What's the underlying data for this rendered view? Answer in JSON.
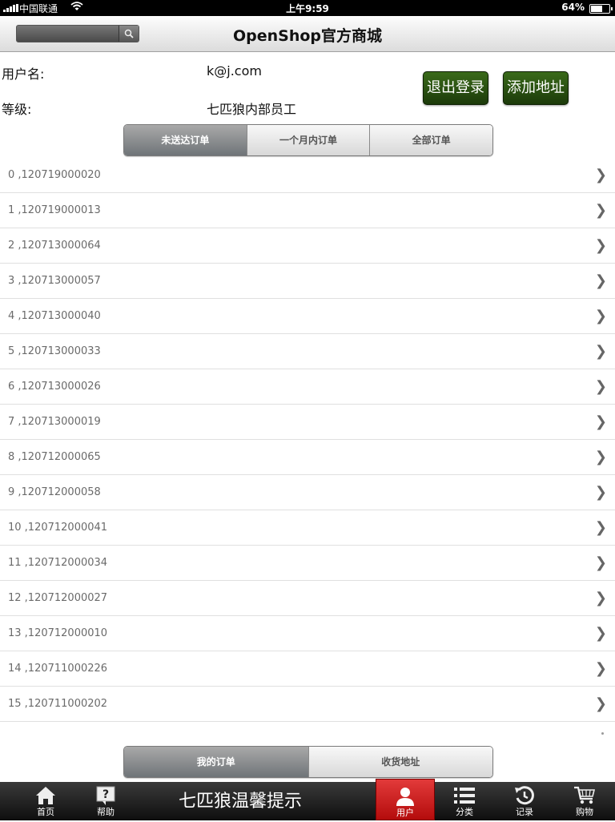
{
  "statusbar": {
    "carrier": "中国联通",
    "time": "上午9:59",
    "battery": "64%",
    "battery_level": 0.64
  },
  "nav": {
    "title": "OpenShop官方商城",
    "search_placeholder": "",
    "search_icon": "search-icon"
  },
  "user": {
    "username_label": "用户名:",
    "username_value": "k@j.com",
    "level_label": "等级:",
    "level_value": "七匹狼内部员工",
    "logout_label": "退出登录",
    "add_address_label": "添加地址"
  },
  "order_tabs": [
    {
      "label": "未送达订单",
      "active": true
    },
    {
      "label": "一个月内订单",
      "active": false
    },
    {
      "label": "全部订单",
      "active": false
    }
  ],
  "orders": [
    "0 ,120719000020",
    "1 ,120719000013",
    "2 ,120713000064",
    "3 ,120713000057",
    "4 ,120713000040",
    "5 ,120713000033",
    "6 ,120713000026",
    "7 ,120713000019",
    "8 ,120712000065",
    "9 ,120712000058",
    "10 ,120712000041",
    "11 ,120712000034",
    "12 ,120712000027",
    "13 ,120712000010",
    "14 ,120711000226",
    "15 ,120711000202"
  ],
  "bottom_tabs": [
    {
      "label": "我的订单",
      "active": true
    },
    {
      "label": "收货地址",
      "active": false
    }
  ],
  "tabbar": {
    "notice": "七匹狼温馨提示",
    "items": [
      {
        "label": "首页",
        "icon": "home-icon",
        "active": false
      },
      {
        "label": "帮助",
        "icon": "help-icon",
        "active": false
      },
      {
        "label": "用户",
        "icon": "user-icon",
        "active": true
      },
      {
        "label": "分类",
        "icon": "list-icon",
        "active": false
      },
      {
        "label": "记录",
        "icon": "history-icon",
        "active": false
      },
      {
        "label": "购物",
        "icon": "cart-icon",
        "active": false
      }
    ]
  },
  "colors": {
    "button_green": "#2c5412",
    "tab_active_red": "#d02020"
  }
}
